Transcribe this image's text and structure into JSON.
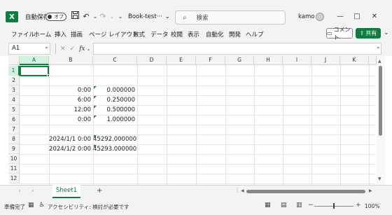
{
  "titlebar": {
    "autosave_label": "自動保存",
    "autosave_state": "オフ",
    "doc_name": "Book-test···",
    "doc_caret": "⌄",
    "search_placeholder": "検索",
    "user_name": "kamo",
    "minimize": "—",
    "maximize": "□",
    "close": "✕"
  },
  "menu": {
    "items": [
      "ファイル",
      "ホーム",
      "挿入",
      "描画",
      "ページ レイアウト",
      "数式",
      "データ",
      "校閲",
      "表示",
      "自動化",
      "開発",
      "ヘルプ"
    ],
    "comment_label": "コメント",
    "share_label": "共有"
  },
  "formula": {
    "name_box": "A1",
    "fx_label": "fx",
    "value": ""
  },
  "columns": [
    "A",
    "B",
    "C",
    "D",
    "E",
    "F",
    "G",
    "H",
    "I",
    "J",
    "K"
  ],
  "rows": [
    "1",
    "2",
    "3",
    "4",
    "5",
    "6",
    "7",
    "8",
    "9",
    "10",
    "11",
    "12"
  ],
  "cells": {
    "B3": "0:00",
    "C3": "0.000000",
    "B4": "6:00",
    "C4": "0.250000",
    "B5": "12:00",
    "C5": "0.500000",
    "B6": "0:00",
    "C6": "1.000000",
    "B8": "2024/1/1 0:00",
    "C8": "45292.000000",
    "B9": "2024/1/2 0:00",
    "C9": "45293.000000"
  },
  "sheets": {
    "active": "Sheet1",
    "add_label": "+"
  },
  "status": {
    "ready": "準備完了",
    "accessibility": "アクセシビリティ: 検討が必要です",
    "zoom": "100%"
  },
  "colors": {
    "accent": "#107c41",
    "error_triangle": "#2e8b2e"
  },
  "icons": {
    "app": "excel-logo-icon",
    "save": "save-icon",
    "undo": "undo-icon",
    "redo": "redo-icon",
    "search": "search-icon"
  }
}
